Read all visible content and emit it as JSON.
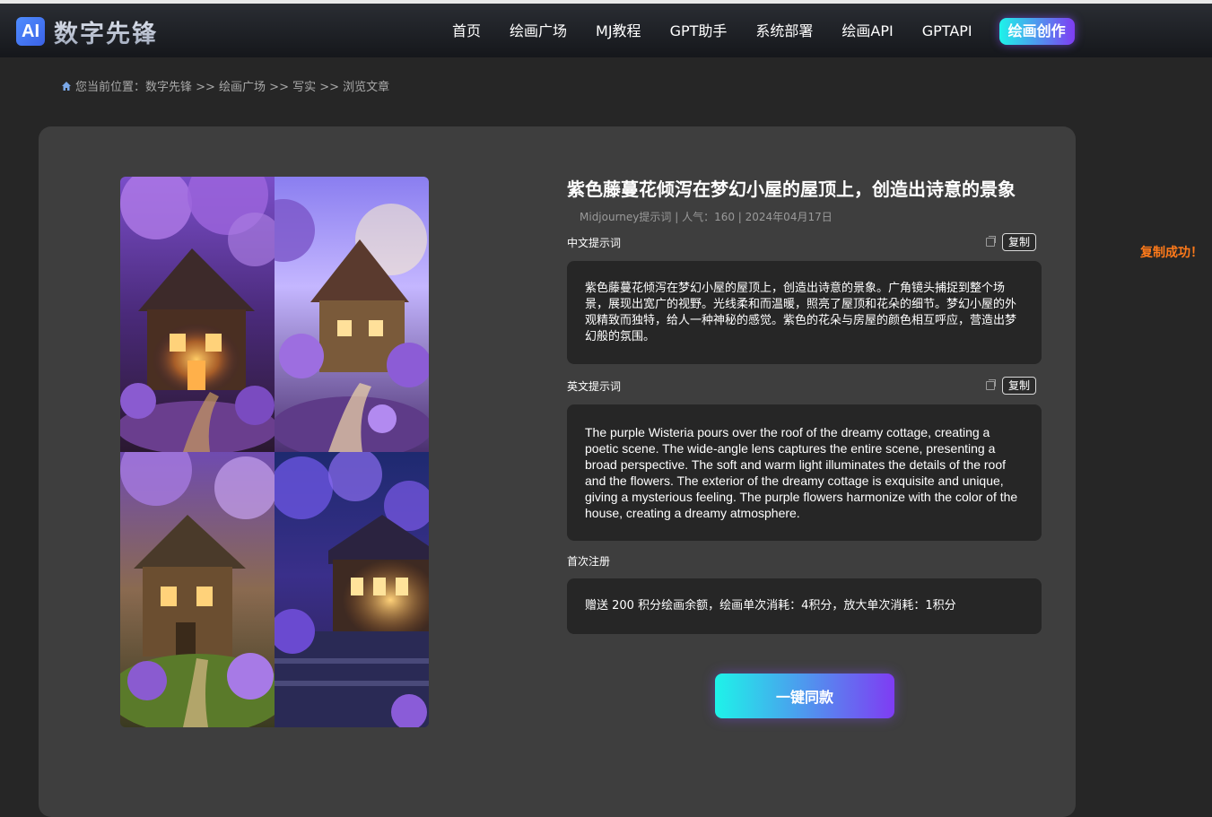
{
  "header": {
    "logo_badge": "AI",
    "logo_text": "数字先锋",
    "nav": [
      "首页",
      "绘画广场",
      "MJ教程",
      "GPT助手",
      "系统部署",
      "绘画API",
      "GPTAPI"
    ],
    "cta_label": "绘画创作"
  },
  "breadcrumb": {
    "text": "您当前位置：数字先锋 >> 绘画广场 >> 写实 >> 浏览文章"
  },
  "article": {
    "title": "紫色藤蔓花倾泻在梦幻小屋的屋顶上，创造出诗意的景象",
    "meta": "Midjourney提示词 | 人气：160 | 2024年04月17日",
    "zh_label": "中文提示词",
    "zh_copy_label": "复制",
    "zh_text": "紫色藤蔓花倾泻在梦幻小屋的屋顶上，创造出诗意的景象。广角镜头捕捉到整个场景，展现出宽广的视野。光线柔和而温暖，照亮了屋顶和花朵的细节。梦幻小屋的外观精致而独特，给人一种神秘的感觉。紫色的花朵与房屋的颜色相互呼应，营造出梦幻般的氛围。",
    "en_label": "英文提示词",
    "en_copy_label": "复制",
    "en_text": "The purple Wisteria pours over the roof of the dreamy cottage, creating a poetic scene. The wide-angle lens captures the entire scene, presenting a broad perspective. The soft and warm light illuminates the details of the roof and the flowers. The exterior of the dreamy cottage is exquisite and unique, giving a mysterious feeling. The purple flowers harmonize with the color of the house, creating a dreamy atmosphere.",
    "reg_label": "首次注册",
    "reg_text": "赠送 200 积分绘画余额，绘画单次消耗：4积分，放大单次消耗：1积分",
    "action_label": "一键同款"
  },
  "toast": "复制成功！",
  "colors": {
    "accent_start": "#1ef3e9",
    "accent_end": "#7f3cf3",
    "toast": "#ff7a1a"
  }
}
